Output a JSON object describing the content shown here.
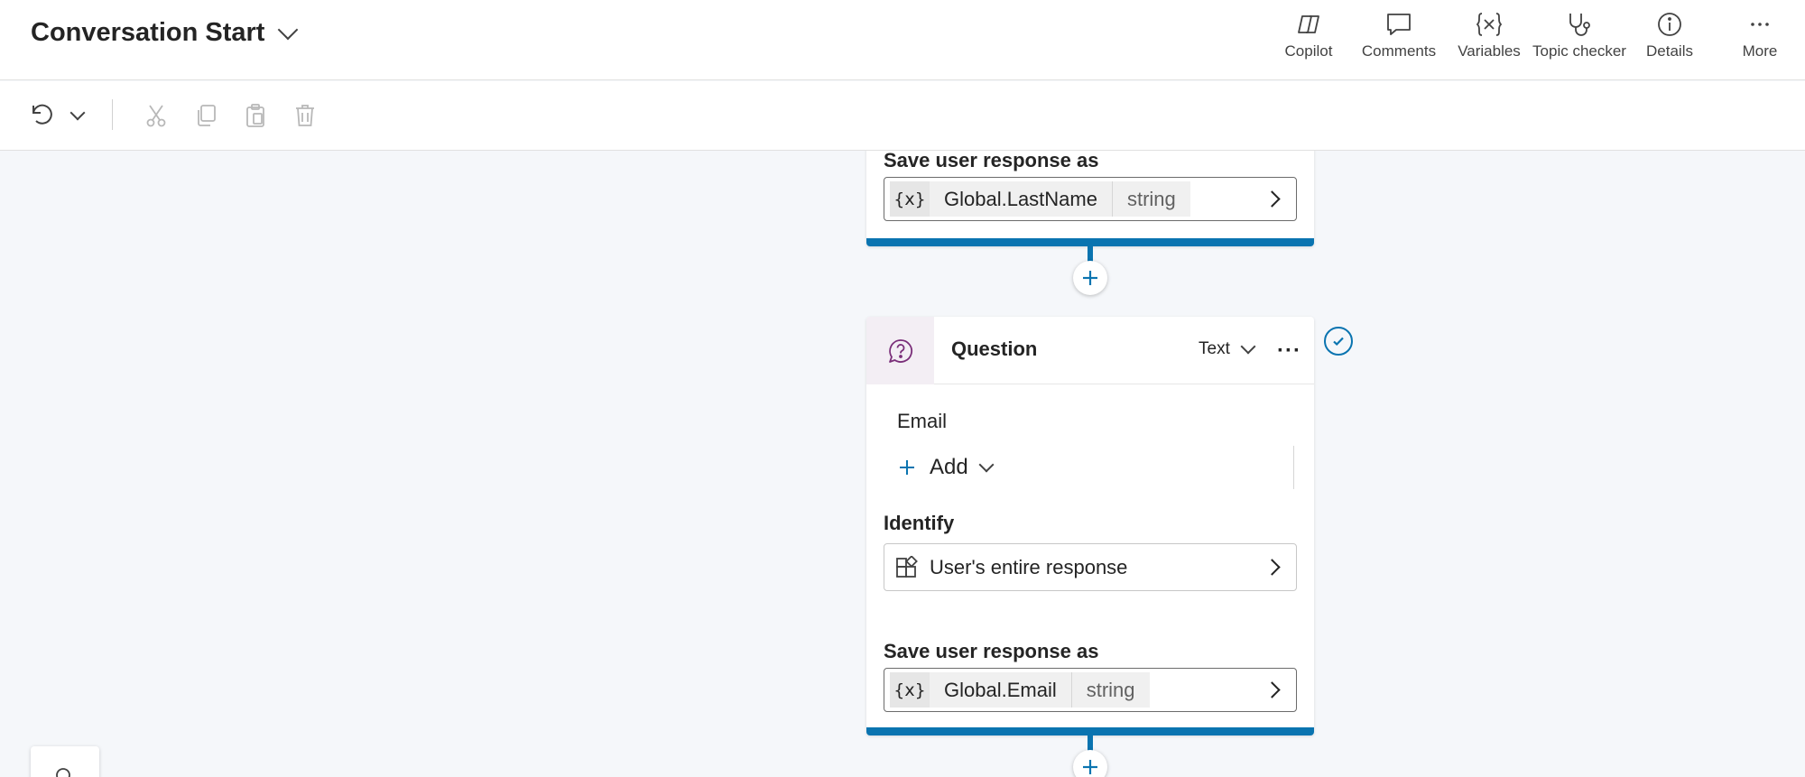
{
  "header": {
    "title": "Conversation Start",
    "tools": [
      {
        "label": "Copilot",
        "icon": "copilot-icon"
      },
      {
        "label": "Comments",
        "icon": "comment-icon"
      },
      {
        "label": "Variables",
        "icon": "variable-icon"
      },
      {
        "label": "Topic checker",
        "icon": "stethoscope-icon"
      },
      {
        "label": "Details",
        "icon": "info-icon"
      },
      {
        "label": "More",
        "icon": "more-icon"
      }
    ]
  },
  "toolbar": {
    "buttons": [
      "undo-icon",
      "chevron-down-icon",
      "cut-icon",
      "copy-icon",
      "paste-icon",
      "delete-icon"
    ]
  },
  "canvas": {
    "top_card": {
      "save_label": "Save user response as",
      "var_icon": "{x}",
      "var_name": "Global.LastName",
      "var_type": "string"
    },
    "question_card": {
      "title": "Question",
      "response_type": "Text",
      "more": "···",
      "message": "Email",
      "add_label": "Add",
      "identify_label": "Identify",
      "identify_value": "User's entire response",
      "save_label": "Save user response as",
      "var_icon": "{x}",
      "var_name": "Global.Email",
      "var_type": "string"
    }
  },
  "colors": {
    "accent": "#0a74b0",
    "question_icon_bg": "#f3eef4",
    "question_icon": "#7a2e79"
  }
}
